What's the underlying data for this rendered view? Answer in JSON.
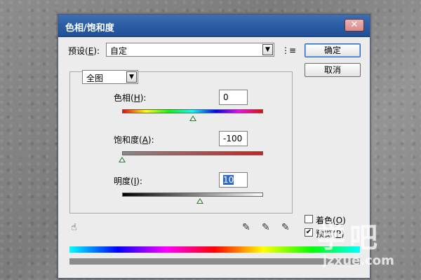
{
  "dialog": {
    "title": "色相/饱和度",
    "close_symbol": "✕"
  },
  "preset": {
    "label_prefix": "预设(",
    "label_key": "E",
    "label_suffix": "):",
    "value": "自定"
  },
  "buttons": {
    "ok": "确定",
    "cancel": "取消"
  },
  "channel": {
    "value": "全图"
  },
  "hue": {
    "label_prefix": "色相(",
    "label_key": "H",
    "label_suffix": "):",
    "value": "0",
    "level": 0.5
  },
  "saturation": {
    "label_prefix": "饱和度(",
    "label_key": "A",
    "label_suffix": "):",
    "value": "-100",
    "level": 0.0
  },
  "lightness": {
    "label_prefix": "明度(",
    "label_key": "I",
    "label_suffix": "):",
    "value": "10",
    "level": 0.55
  },
  "colorize": {
    "label_prefix": "着色(",
    "label_key": "O",
    "label_suffix": ")",
    "checked": false
  },
  "preview": {
    "label_prefix": "预览(",
    "label_key": "P",
    "label_suffix": ")",
    "checked": true
  },
  "icons": {
    "presets_menu": "presets-menu-icon",
    "hand_adjust": "hand-adjust-icon",
    "eyedropper": "eyedropper-icon",
    "eyedropper_plus": "eyedropper-plus-icon",
    "eyedropper_minus": "eyedropper-minus-icon"
  },
  "watermark": {
    "main": "学吧",
    "sub": "jzxue.com"
  },
  "colors": {
    "titlebar": "#2b5ea6",
    "default_button_border": "#2f65b5",
    "thumb": "#2c7a2c",
    "selection": "#316ac5"
  }
}
